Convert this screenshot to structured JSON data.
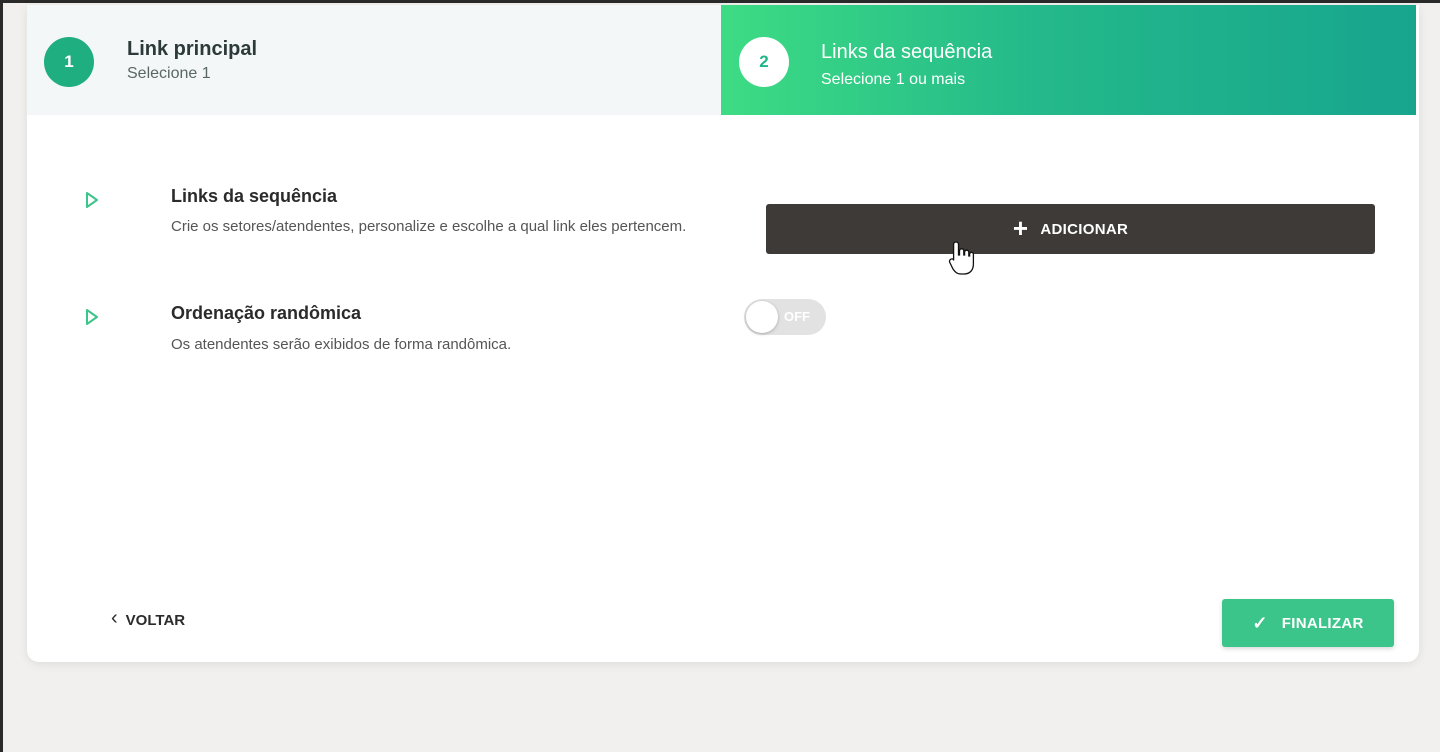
{
  "stepper": {
    "step1": {
      "number": "1",
      "title": "Link principal",
      "subtitle": "Selecione 1"
    },
    "step2": {
      "number": "2",
      "title": "Links da sequência",
      "subtitle": "Selecione 1 ou mais"
    }
  },
  "sections": [
    {
      "title": "Links da sequência",
      "description": "Crie os setores/atendentes, personalize e escolhe a qual link eles pertencem.",
      "icon": "play-triangle-icon"
    },
    {
      "title": "Ordenação randômica",
      "description": "Os atendentes serão exibidos de forma randômica.",
      "icon": "play-triangle-icon"
    }
  ],
  "add_button": {
    "label": "ADICIONAR",
    "icon": "plus-icon"
  },
  "random_toggle": {
    "state_label": "OFF",
    "checked": false
  },
  "footer": {
    "back_label": "VOLTAR",
    "finish_label": "FINALIZAR"
  },
  "colors": {
    "accent": "#3cc58a",
    "dark_button": "#3d3a37",
    "step_gradient_start": "#3ddc84",
    "step_gradient_end": "#17a58e"
  }
}
